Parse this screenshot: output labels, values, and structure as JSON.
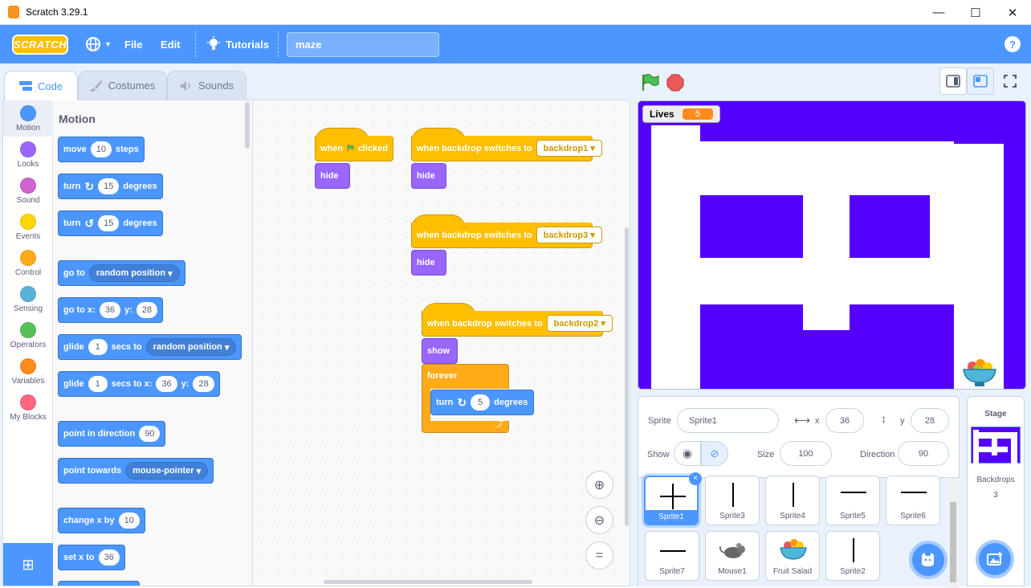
{
  "window": {
    "title": "Scratch 3.29.1",
    "min": "—",
    "max": "☐",
    "close": "✕"
  },
  "menu": {
    "file": "File",
    "edit": "Edit",
    "tutorials": "Tutorials",
    "project_title": "maze",
    "logo": "SCRATCH",
    "help": "?"
  },
  "tabs": {
    "code": "Code",
    "costumes": "Costumes",
    "sounds": "Sounds"
  },
  "categories": [
    {
      "label": "Motion",
      "color": "#4c97ff"
    },
    {
      "label": "Looks",
      "color": "#9966ff"
    },
    {
      "label": "Sound",
      "color": "#cf63cf"
    },
    {
      "label": "Events",
      "color": "#ffd500"
    },
    {
      "label": "Control",
      "color": "#ffab19"
    },
    {
      "label": "Sensing",
      "color": "#5cb1d6"
    },
    {
      "label": "Operators",
      "color": "#59c059"
    },
    {
      "label": "Variables",
      "color": "#ff8c1a"
    },
    {
      "label": "My Blocks",
      "color": "#ff6680"
    }
  ],
  "palette": {
    "title": "Motion",
    "move": {
      "a": "move",
      "n": "10",
      "b": "steps"
    },
    "turn_right": {
      "a": "turn",
      "n": "15",
      "b": "degrees"
    },
    "turn_left": {
      "a": "turn",
      "n": "15",
      "b": "degrees"
    },
    "go_to": {
      "a": "go to",
      "d": "random position"
    },
    "go_to_xy": {
      "a": "go to x:",
      "x": "36",
      "b": "y:",
      "y": "28"
    },
    "glide": {
      "a": "glide",
      "n": "1",
      "b": "secs to",
      "d": "random position"
    },
    "glide_xy": {
      "a": "glide",
      "n": "1",
      "b": "secs to x:",
      "x": "36",
      "c": "y:",
      "y": "28"
    },
    "point_dir": {
      "a": "point in direction",
      "n": "90"
    },
    "point_towards": {
      "a": "point towards",
      "d": "mouse-pointer"
    },
    "change_x": {
      "a": "change x by",
      "n": "10"
    },
    "set_x": {
      "a": "set x to",
      "n": "36"
    }
  },
  "scripts": {
    "s1": {
      "when": "when",
      "clicked": "clicked",
      "hide": "hide"
    },
    "s2": {
      "label": "when backdrop switches to",
      "backdrop": "backdrop1",
      "hide": "hide"
    },
    "s3": {
      "label": "when backdrop switches to",
      "backdrop": "backdrop3",
      "hide": "hide"
    },
    "s4": {
      "label": "when backdrop switches to",
      "backdrop": "backdrop2",
      "show": "show",
      "forever": "forever",
      "turn": "turn",
      "n": "5",
      "deg": "degrees"
    }
  },
  "zoom": {
    "reset": "="
  },
  "stage": {
    "lives_label": "Lives",
    "lives_value": "5"
  },
  "sprite_info": {
    "sprite_label": "Sprite",
    "sprite_name": "Sprite1",
    "x_label": "x",
    "x": "36",
    "y_label": "y",
    "y": "28",
    "show_label": "Show",
    "size_label": "Size",
    "size": "100",
    "direction_label": "Direction",
    "direction": "90"
  },
  "sprites": [
    "Sprite1",
    "Sprite3",
    "Sprite4",
    "Sprite5",
    "Sprite6",
    "Sprite7",
    "Mouse1",
    "Fruit Salad",
    "Sprite2"
  ],
  "stage_pane": {
    "title": "Stage",
    "backdrops_label": "Backdrops",
    "backdrops_count": "3"
  },
  "colors": {
    "accent": "#4c97ff",
    "maze": "#5500ff",
    "events": "#ffbf00",
    "looks": "#9966ff",
    "control": "#ffab19"
  }
}
